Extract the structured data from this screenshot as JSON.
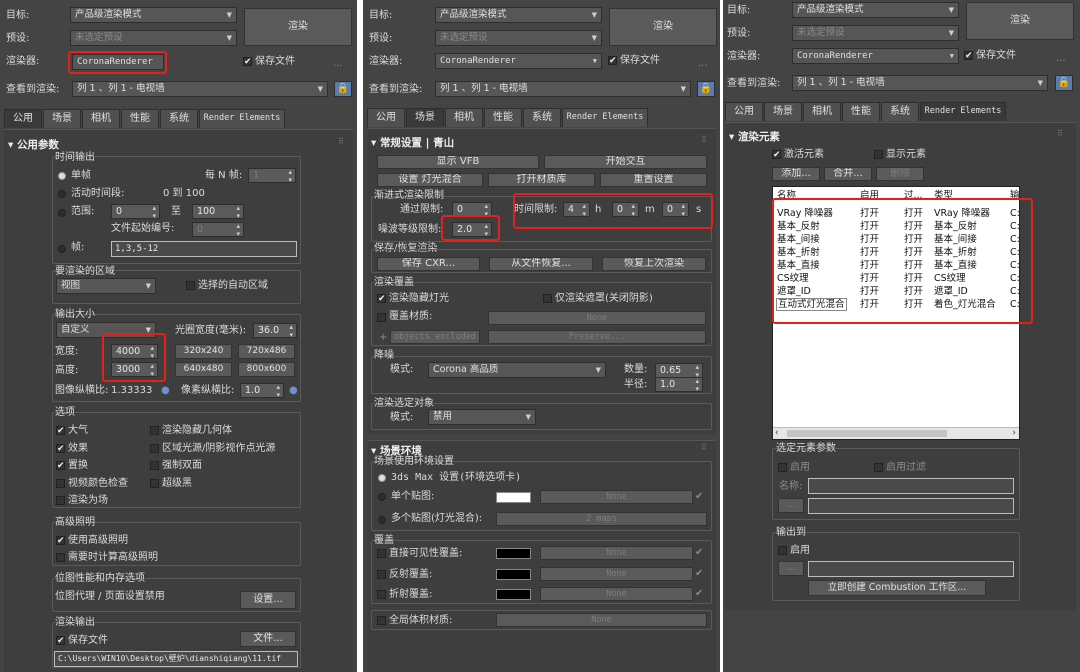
{
  "common": {
    "target_label": "目标:",
    "preset_label": "预设:",
    "renderer_label": "渲染器:",
    "view_label": "查看到渲染:",
    "target_value": "产品级渲染模式",
    "preset_value": "未选定预设",
    "renderer_value": "CoronaRenderer",
    "view_value": "列 1 、列 1 - 电视墙",
    "render_button": "渲染",
    "save_file": "保存文件",
    "dots": "...",
    "tabs": [
      "公用",
      "场景",
      "相机",
      "性能",
      "系统",
      "Render Elements"
    ]
  },
  "p1": {
    "rollout": "公用参数",
    "time_output": "时间输出",
    "single": "单帧",
    "every_n": "每 N 帧:",
    "every_n_val": "1",
    "active_seg": "活动时间段:",
    "active_range": "0 到 100",
    "range": "范围:",
    "range_from": "0",
    "range_to_label": "至",
    "range_to": "100",
    "file_start": "文件起始编号:",
    "file_start_val": "0",
    "frames": "帧:",
    "frames_val": "1,3,5-12",
    "area": "要渲染的区域",
    "area_val": "视图",
    "auto_area": "选择的自动区域",
    "out_size": "输出大小",
    "custom": "自定义",
    "aperture": "光圈宽度(毫米):",
    "aperture_val": "36.0",
    "width": "宽度:",
    "width_val": "4000",
    "height": "高度:",
    "height_val": "3000",
    "presets": [
      "320x240",
      "720x486",
      "640x480",
      "800x600"
    ],
    "img_aspect": "图像纵横比:",
    "img_aspect_val": "1.33333",
    "px_aspect": "像素纵横比:",
    "px_aspect_val": "1.0",
    "options": "选项",
    "opt": [
      "大气",
      "效果",
      "置换",
      "视频颜色检查",
      "渲染为场"
    ],
    "opt2": [
      "渲染隐藏几何体",
      "区域光源/阴影视作点光源",
      "强制双面",
      "超级黑"
    ],
    "adv": "高级照明",
    "use_adv": "使用高级照明",
    "need_adv": "需要时计算高级照明",
    "bitmap": "位图性能和内存选项",
    "proxy": "位图代理 / 页面设置禁用",
    "setup": "设置...",
    "render_out": "渲染输出",
    "save_file": "保存文件",
    "file_btn": "文件...",
    "path": "C:\\Users\\WIN10\\Desktop\\壁炉\\dianshiqiang\\11.tif"
  },
  "p2": {
    "rollout1": "常规设置 | 青山",
    "show_vfb": "显示 VFB",
    "start_ir": "开始交互",
    "set_mix": "设置 灯光混合",
    "open_mtl": "打开材质库",
    "reset": "重置设置",
    "prog": "渐进式渲染限制",
    "pass": "通过限制:",
    "pass_val": "0",
    "time": "时间限制:",
    "time_h": "4",
    "h": "h",
    "time_m": "0",
    "m": "m",
    "time_s": "0",
    "s": "s",
    "noise": "噪波等级限制:",
    "noise_val": "2.0",
    "saveload": "保存/恢复渲染",
    "save_cxr": "保存 CXR...",
    "from_file": "从文件恢复...",
    "restore_last": "恢复上次渲染",
    "override": "渲染覆盖",
    "hidden_lights": "渲染隐藏灯光",
    "mask_only": "仅渲染遮罩(关闭阴影)",
    "mtl_override": "覆盖材质:",
    "none": "None",
    "objects_excluded": "objects excluded",
    "preserve": "Preserve...",
    "denoise": "降噪",
    "mode": "模式:",
    "denoise_val": "Corona 高品质",
    "amount": "数量:",
    "amount_val": "0.65",
    "radius": "半径:",
    "radius_val": "1.0",
    "sel_obj": "渲染选定对象",
    "sel_mode": "模式:",
    "sel_val": "禁用",
    "rollout2": "场景环境",
    "use_env": "场景使用环境设置",
    "max_env": "3ds Max 设置(环境选项卡)",
    "single_map": "单个贴图:",
    "multi_map": "多个贴图(灯光混合):",
    "maps2": "2 maps",
    "overrides": "覆盖",
    "direct": "直接可见性覆盖:",
    "refl": "反射覆盖:",
    "refr": "折射覆盖:",
    "global_vol": "全局体积材质:"
  },
  "p3": {
    "rollout": "渲染元素",
    "active": "激活元素",
    "show": "显示元素",
    "add": "添加...",
    "merge": "合并...",
    "delete": "删除",
    "cols": [
      "名称",
      "启用",
      "过...",
      "类型",
      "输"
    ],
    "rows": [
      [
        "VRay 降噪器",
        "打开",
        "打开",
        "VRay 降噪器",
        "C:"
      ],
      [
        "基本_反射",
        "打开",
        "打开",
        "基本_反射",
        "C:"
      ],
      [
        "基本_间接",
        "打开",
        "打开",
        "基本_间接",
        "C:"
      ],
      [
        "基本_折射",
        "打开",
        "打开",
        "基本_折射",
        "C:"
      ],
      [
        "基本_直接",
        "打开",
        "打开",
        "基本_直接",
        "C:"
      ],
      [
        "CS纹理",
        "打开",
        "打开",
        "CS纹理",
        "C:"
      ],
      [
        "遮罩_ID",
        "打开",
        "打开",
        "遮罩_ID",
        "C:"
      ],
      [
        "互动式灯光混合",
        "打开",
        "打开",
        "着色_灯光混合",
        "C:"
      ]
    ],
    "sel_params": "选定元素参数",
    "enable": "启用",
    "enable_filter": "启用过滤",
    "name": "名称:",
    "output_to": "输出到",
    "out_enable": "启用",
    "combustion": "立即创建 Combustion 工作区..."
  }
}
